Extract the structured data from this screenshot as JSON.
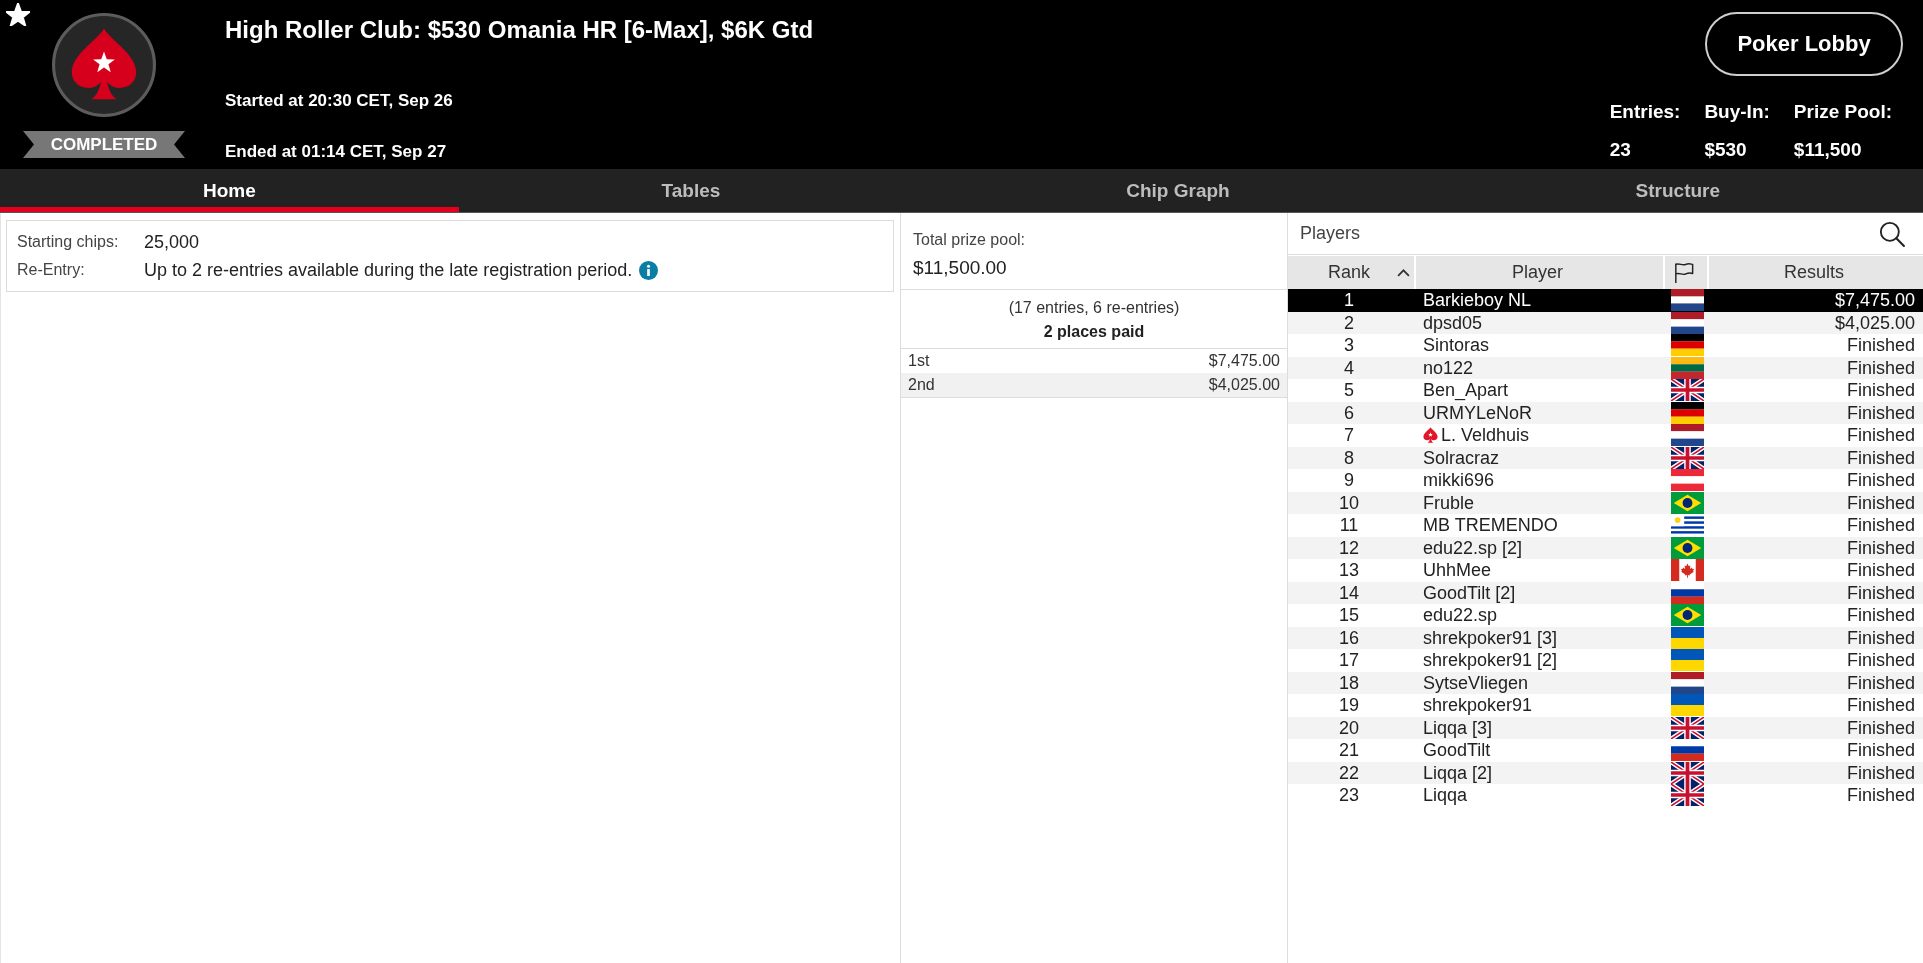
{
  "header": {
    "favorite": true,
    "status": "COMPLETED",
    "title": "High Roller Club: $530 Omania HR [6-Max], $6K Gtd",
    "started": "Started at 20:30 CET, Sep 26",
    "ended": "Ended at 01:14 CET, Sep 27",
    "lobby_button": "Poker Lobby",
    "stats": [
      {
        "label": "Entries:",
        "value": "23"
      },
      {
        "label": "Buy-In:",
        "value": "$530"
      },
      {
        "label": "Prize Pool:",
        "value": "$11,500"
      }
    ]
  },
  "tabs": [
    {
      "label": "Home",
      "selected": true
    },
    {
      "label": "Tables",
      "selected": false
    },
    {
      "label": "Chip Graph",
      "selected": false
    },
    {
      "label": "Structure",
      "selected": false
    }
  ],
  "details": [
    {
      "label": "Starting chips:",
      "value": "25,000",
      "info": false
    },
    {
      "label": "Re-Entry:",
      "value": "Up to 2 re-entries available during the late registration period.",
      "info": true
    }
  ],
  "prizes": {
    "total_label": "Total prize pool:",
    "total": "$11,500.00",
    "entries_note": "(17 entries, 6 re-entries)",
    "places_paid": "2 places paid",
    "payouts": [
      {
        "place": "1st",
        "amount": "$7,475.00"
      },
      {
        "place": "2nd",
        "amount": "$4,025.00"
      }
    ]
  },
  "players": {
    "title": "Players",
    "columns": [
      {
        "kind": "text",
        "label": "Rank",
        "sorted": true
      },
      {
        "kind": "text",
        "label": "Player",
        "sorted": false
      },
      {
        "kind": "flag",
        "sorted": false
      },
      {
        "kind": "text",
        "label": "Results",
        "sorted": false
      }
    ],
    "rows": [
      {
        "rank": "1",
        "name": "Barkieboy NL",
        "flag": {
          "kind": "netherlands"
        },
        "result": "$7,475.00",
        "selected": true,
        "badge": false
      },
      {
        "rank": "2",
        "name": "dpsd05",
        "flag": {
          "kind": "netherlands"
        },
        "result": "$4,025.00",
        "selected": false,
        "badge": false
      },
      {
        "rank": "3",
        "name": "Sintoras",
        "flag": {
          "kind": "germany"
        },
        "result": "Finished",
        "selected": false,
        "badge": false
      },
      {
        "rank": "4",
        "name": "no122",
        "flag": {
          "kind": "lithuania"
        },
        "result": "Finished",
        "selected": false,
        "badge": false
      },
      {
        "rank": "5",
        "name": "Ben_Apart",
        "flag": {
          "kind": "uk"
        },
        "result": "Finished",
        "selected": false,
        "badge": false
      },
      {
        "rank": "6",
        "name": "URMYLeNoR",
        "flag": {
          "kind": "germany"
        },
        "result": "Finished",
        "selected": false,
        "badge": false
      },
      {
        "rank": "7",
        "name": "L. Veldhuis",
        "flag": {
          "kind": "netherlands"
        },
        "result": "Finished",
        "selected": false,
        "badge": true
      },
      {
        "rank": "8",
        "name": "Solracraz",
        "flag": {
          "kind": "uk"
        },
        "result": "Finished",
        "selected": false,
        "badge": false
      },
      {
        "rank": "9",
        "name": "mikki696",
        "flag": {
          "kind": "austria"
        },
        "result": "Finished",
        "selected": false,
        "badge": false
      },
      {
        "rank": "10",
        "name": "Fruble",
        "flag": {
          "kind": "brazil"
        },
        "result": "Finished",
        "selected": false,
        "badge": false
      },
      {
        "rank": "11",
        "name": "MB TREMENDO",
        "flag": {
          "kind": "uruguay"
        },
        "result": "Finished",
        "selected": false,
        "badge": false
      },
      {
        "rank": "12",
        "name": "edu22.sp [2]",
        "flag": {
          "kind": "brazil"
        },
        "result": "Finished",
        "selected": false,
        "badge": false
      },
      {
        "rank": "13",
        "name": "UhhMee",
        "flag": {
          "kind": "canada"
        },
        "result": "Finished",
        "selected": false,
        "badge": false
      },
      {
        "rank": "14",
        "name": "GoodTilt [2]",
        "flag": {
          "kind": "russia"
        },
        "result": "Finished",
        "selected": false,
        "badge": false
      },
      {
        "rank": "15",
        "name": "edu22.sp",
        "flag": {
          "kind": "brazil"
        },
        "result": "Finished",
        "selected": false,
        "badge": false
      },
      {
        "rank": "16",
        "name": "shrekpoker91 [3]",
        "flag": {
          "kind": "ukraine"
        },
        "result": "Finished",
        "selected": false,
        "badge": false
      },
      {
        "rank": "17",
        "name": "shrekpoker91 [2]",
        "flag": {
          "kind": "ukraine"
        },
        "result": "Finished",
        "selected": false,
        "badge": false
      },
      {
        "rank": "18",
        "name": "SytseVliegen",
        "flag": {
          "kind": "netherlands"
        },
        "result": "Finished",
        "selected": false,
        "badge": false
      },
      {
        "rank": "19",
        "name": "shrekpoker91",
        "flag": {
          "kind": "ukraine"
        },
        "result": "Finished",
        "selected": false,
        "badge": false
      },
      {
        "rank": "20",
        "name": "Liqqa [3]",
        "flag": {
          "kind": "uk"
        },
        "result": "Finished",
        "selected": false,
        "badge": false
      },
      {
        "rank": "21",
        "name": "GoodTilt",
        "flag": {
          "kind": "russia"
        },
        "result": "Finished",
        "selected": false,
        "badge": false
      },
      {
        "rank": "22",
        "name": "Liqqa [2]",
        "flag": {
          "kind": "uk"
        },
        "result": "Finished",
        "selected": false,
        "badge": false
      },
      {
        "rank": "23",
        "name": "Liqqa",
        "flag": {
          "kind": "uk"
        },
        "result": "Finished",
        "selected": false,
        "badge": false
      }
    ]
  }
}
